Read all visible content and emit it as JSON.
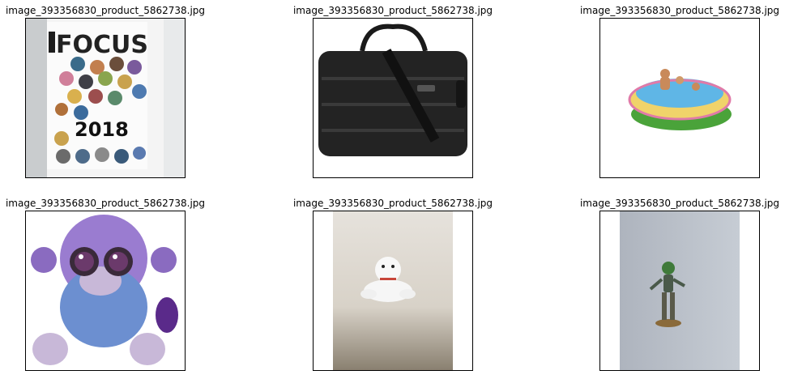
{
  "figure": {
    "panels": [
      {
        "title": "image_393356830_product_5862738.jpg",
        "subject": "magazine-cover",
        "cover_masthead": "FOCUS",
        "cover_year": "2018"
      },
      {
        "title": "image_393356830_product_5862738.jpg",
        "subject": "laptop-bag"
      },
      {
        "title": "image_393356830_product_5862738.jpg",
        "subject": "inflatable-pool"
      },
      {
        "title": "image_393356830_product_5862738.jpg",
        "subject": "plush-monkey"
      },
      {
        "title": "image_393356830_product_5862738.jpg",
        "subject": "toy-polar-bear"
      },
      {
        "title": "image_393356830_product_5862738.jpg",
        "subject": "miniature-figurine"
      }
    ]
  }
}
